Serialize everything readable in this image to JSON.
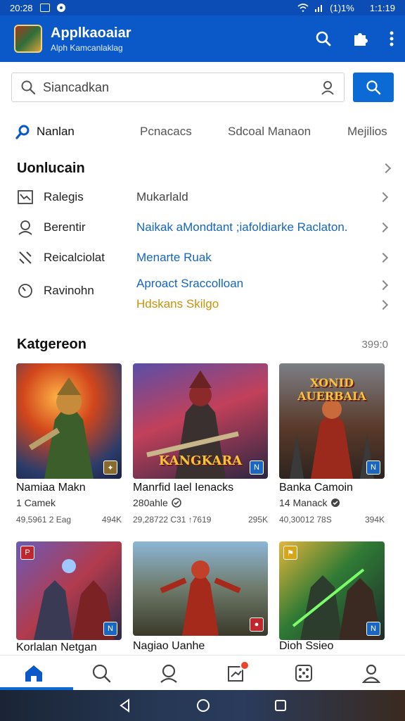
{
  "status": {
    "time_left": "20:28",
    "battery": "(1)1%",
    "time_right": "1:1:19"
  },
  "app": {
    "title": "Applkaoaiar",
    "subtitle": "Alph Kamcanlaklag"
  },
  "search": {
    "value": "Siancadkan"
  },
  "tabs": [
    {
      "label": "Nanlan"
    },
    {
      "label": "Pcnacacs"
    },
    {
      "label": "Sdcoal Manaon"
    },
    {
      "label": "Mejilios"
    }
  ],
  "section": {
    "title": "Uonlucain"
  },
  "rows": [
    {
      "label": "Ralegis",
      "value": "Mukarlald",
      "icon": "chart-icon"
    },
    {
      "label": "Berentir",
      "value": "Naikak aMondtant ;iafoldiarke Raclaton.",
      "icon": "user-icon"
    },
    {
      "label": "Reicalciolat",
      "value": "Menarte Ruak",
      "icon": "tool-icon"
    },
    {
      "label": "Ravinohn",
      "value": "Aproact Sraccolloan",
      "value2": "Hdskans Skilgo",
      "icon": "clock-icon"
    }
  ],
  "categories": {
    "title": "Katgereon",
    "count": "399:0",
    "cards": [
      {
        "name": "Namiaa Makn",
        "sub": "1 Camek",
        "meta_left": "49,5961 2 Eag",
        "meta_right": "494K",
        "thumb_text": ""
      },
      {
        "name": "Manrfid Iael Ienacks",
        "sub": "280ahle",
        "meta_left": "29,28722 C31 ↑7619",
        "meta_right": "295K",
        "thumb_text": "KANGKARA"
      },
      {
        "name": "Banka Camoin",
        "sub": "14 Manack",
        "meta_left": "40,30012 78S",
        "meta_right": "394K",
        "thumb_text": "XONID AUERBAIA"
      },
      {
        "name": "Korlalan Netgan",
        "sub": "",
        "meta_left": "",
        "meta_right": "",
        "thumb_text": ""
      },
      {
        "name": "Nagiao Uanhe",
        "sub": "",
        "meta_left": "",
        "meta_right": "",
        "thumb_text": ""
      },
      {
        "name": "Dioh Ssieo",
        "sub": "",
        "meta_left": "",
        "meta_right": "",
        "thumb_text": ""
      }
    ]
  },
  "bottom_nav": [
    "home-icon",
    "search-icon",
    "profile-icon",
    "notifications-icon",
    "games-icon",
    "account-icon"
  ],
  "colors": {
    "primary": "#0b59c8",
    "accent": "#0b6ad4",
    "link": "#1565c0",
    "gold": "#c9920a"
  }
}
